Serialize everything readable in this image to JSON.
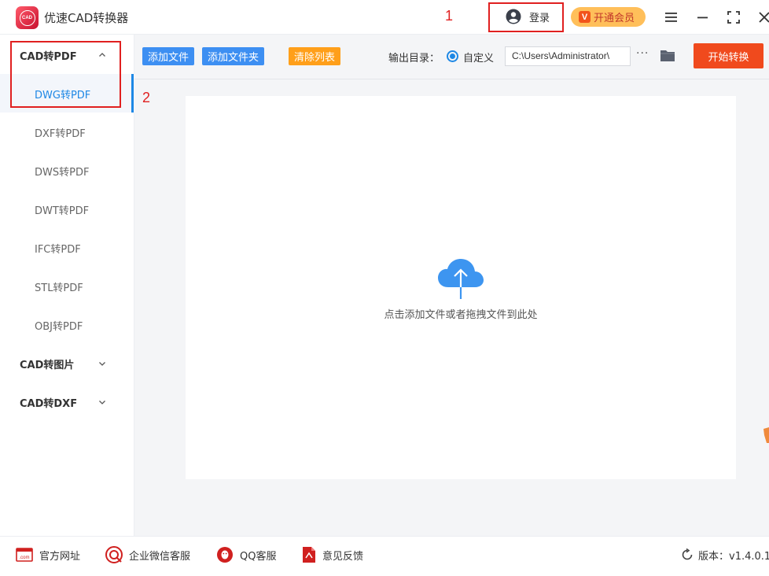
{
  "app": {
    "title": "优速CAD转换器",
    "logo_text": "CAD"
  },
  "annotations": {
    "marker_1": "1",
    "marker_2": "2"
  },
  "header": {
    "login_label": "登录",
    "vip_label": "开通会员",
    "vip_badge": "V",
    "icons": [
      "user-icon",
      "menu-icon",
      "minimize-icon",
      "fullscreen-icon",
      "close-icon"
    ]
  },
  "sidebar": {
    "groups": [
      {
        "label": "CAD转PDF",
        "expanded": true,
        "items": [
          {
            "label": "DWG转PDF",
            "active": true
          },
          {
            "label": "DXF转PDF"
          },
          {
            "label": "DWS转PDF"
          },
          {
            "label": "DWT转PDF"
          },
          {
            "label": "IFC转PDF"
          },
          {
            "label": "STL转PDF"
          },
          {
            "label": "OBJ转PDF"
          }
        ]
      },
      {
        "label": "CAD转图片",
        "expanded": false
      },
      {
        "label": "CAD转DXF",
        "expanded": false
      }
    ]
  },
  "toolbar": {
    "add_file": "添加文件",
    "add_folder": "添加文件夹",
    "clear_list": "清除列表",
    "output_label": "输出目录：",
    "radio_label": "自定义",
    "output_path": "C:\\Users\\Administrator\\",
    "more": "···",
    "start": "开始转换"
  },
  "dropzone": {
    "text": "点击添加文件或者拖拽文件到此处",
    "icon": "cloud-upload-icon"
  },
  "footer": {
    "links": [
      "官方网址",
      "企业微信客服",
      "QQ客服",
      "意见反馈"
    ],
    "version": "版本：v1.4.0.1"
  },
  "colors": {
    "accent_blue": "#1e88e5",
    "button_blue": "#3d8ff2",
    "button_orange": "#ff9f1a",
    "start_red": "#f04a1d",
    "vip_gold": "#ffbf5a",
    "annotation_red": "#e02020"
  }
}
